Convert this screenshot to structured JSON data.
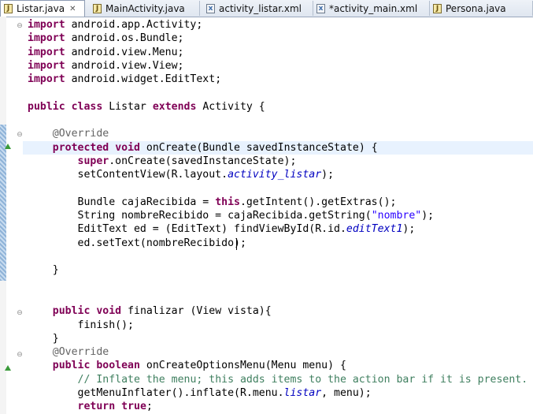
{
  "tabs": [
    {
      "label": "Listar.java",
      "icon": "java-file-icon",
      "active": true,
      "close": "✕"
    },
    {
      "label": "MainActivity.java",
      "icon": "java-file-icon"
    },
    {
      "label": "activity_listar.xml",
      "icon": "xml-file-icon"
    },
    {
      "label": "*activity_main.xml",
      "icon": "xml-file-icon"
    },
    {
      "label": "Persona.java",
      "icon": "java-file-icon"
    }
  ],
  "code_lines": [
    [
      [
        "kw",
        "import"
      ],
      [
        "n",
        " android.app.Activity;"
      ]
    ],
    [
      [
        "kw",
        "import"
      ],
      [
        "n",
        " android.os.Bundle;"
      ]
    ],
    [
      [
        "kw",
        "import"
      ],
      [
        "n",
        " android.view.Menu;"
      ]
    ],
    [
      [
        "kw",
        "import"
      ],
      [
        "n",
        " android.view.View;"
      ]
    ],
    [
      [
        "kw",
        "import"
      ],
      [
        "n",
        " android.widget.EditText;"
      ]
    ],
    [],
    [
      [
        "kw",
        "public"
      ],
      [
        "n",
        " "
      ],
      [
        "kw",
        "class"
      ],
      [
        "n",
        " Listar "
      ],
      [
        "kw",
        "extends"
      ],
      [
        "n",
        " Activity {"
      ]
    ],
    [],
    [
      [
        "n",
        "    "
      ],
      [
        "ann",
        "@Override"
      ]
    ],
    [
      [
        "n",
        "    "
      ],
      [
        "kw",
        "protected"
      ],
      [
        "n",
        " "
      ],
      [
        "kw",
        "void"
      ],
      [
        "n",
        " onCreate(Bundle savedInstanceState) {"
      ]
    ],
    [
      [
        "n",
        "        "
      ],
      [
        "kw",
        "super"
      ],
      [
        "n",
        ".onCreate(savedInstanceState);"
      ]
    ],
    [
      [
        "n",
        "        setContentView(R.layout."
      ],
      [
        "fld",
        "activity_listar"
      ],
      [
        "n",
        ");"
      ]
    ],
    [],
    [
      [
        "n",
        "        Bundle cajaRecibida = "
      ],
      [
        "kw",
        "this"
      ],
      [
        "n",
        ".getIntent().getExtras();"
      ]
    ],
    [
      [
        "n",
        "        String nombreRecibido = cajaRecibida.getString("
      ],
      [
        "str",
        "\"nombre\""
      ],
      [
        "n",
        ");"
      ]
    ],
    [
      [
        "n",
        "        EditText ed = (EditText) findViewById(R.id."
      ],
      [
        "fld",
        "editText1"
      ],
      [
        "n",
        ");"
      ]
    ],
    [
      [
        "n",
        "        ed.setText(nombreRecibido);"
      ]
    ],
    [],
    [
      [
        "n",
        "    }"
      ]
    ],
    [],
    [],
    [
      [
        "n",
        "    "
      ],
      [
        "kw",
        "public"
      ],
      [
        "n",
        " "
      ],
      [
        "kw",
        "void"
      ],
      [
        "n",
        " finalizar (View vista){"
      ]
    ],
    [
      [
        "n",
        "        finish();"
      ]
    ],
    [
      [
        "n",
        "    }"
      ]
    ],
    [
      [
        "n",
        "    "
      ],
      [
        "ann",
        "@Override"
      ]
    ],
    [
      [
        "n",
        "    "
      ],
      [
        "kw",
        "public"
      ],
      [
        "n",
        " "
      ],
      [
        "kw",
        "boolean"
      ],
      [
        "n",
        " onCreateOptionsMenu(Menu menu) {"
      ]
    ],
    [
      [
        "n",
        "        "
      ],
      [
        "cmt",
        "// Inflate the menu; this adds items to the action bar if it is present."
      ]
    ],
    [
      [
        "n",
        "        getMenuInflater().inflate(R.menu."
      ],
      [
        "fld",
        "listar"
      ],
      [
        "n",
        ", menu);"
      ]
    ],
    [
      [
        "n",
        "        "
      ],
      [
        "kw",
        "return"
      ],
      [
        "n",
        " "
      ],
      [
        "kw",
        "true"
      ],
      [
        "n",
        ";"
      ]
    ]
  ]
}
